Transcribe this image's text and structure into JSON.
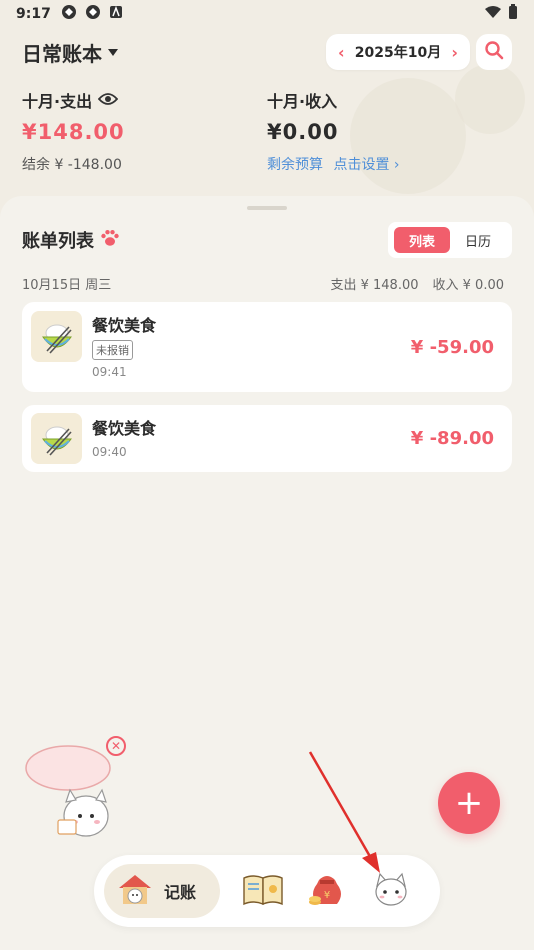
{
  "status_bar": {
    "time": "9:17"
  },
  "header": {
    "book_title": "日常账本",
    "month_label": "2025年10月",
    "prev_glyph": "‹",
    "next_glyph": "›"
  },
  "summary": {
    "expense_label": "十月·支出",
    "expense_amount": "¥148.00",
    "income_label": "十月·收入",
    "income_amount": "¥0.00",
    "balance_text": "结余 ¥ -148.00",
    "budget_left": "剩余预算",
    "budget_set": "点击设置 ›"
  },
  "list": {
    "title": "账单列表",
    "tabs": [
      {
        "label": "列表",
        "active": true
      },
      {
        "label": "日历",
        "active": false
      }
    ],
    "date_group": {
      "date": "10月15日 周三",
      "expense": "支出 ¥ 148.00",
      "income": "收入 ¥ 0.00"
    },
    "items": [
      {
        "category": "餐饮美食",
        "tag": "未报销",
        "time": "09:41",
        "amount": "¥ -59.00"
      },
      {
        "category": "餐饮美食",
        "tag": "",
        "time": "09:40",
        "amount": "¥ -89.00"
      }
    ]
  },
  "fab": {
    "label": "+"
  },
  "bottom_nav": {
    "active_label": "记账",
    "icons": [
      "house-cat-icon",
      "book-icon",
      "money-bag-icon",
      "cat-profile-icon"
    ]
  },
  "colors": {
    "accent": "#f15e6c",
    "link": "#4f8fd8",
    "background": "#f1ede4"
  }
}
